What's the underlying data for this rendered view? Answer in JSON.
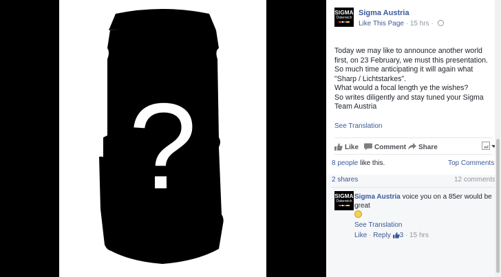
{
  "photo": {
    "symbol": "?"
  },
  "post": {
    "page_name": "Sigma Austria",
    "like_page": "Like This Page",
    "time": "· 15 hrs ·",
    "avatar_line1": "SIGMA",
    "avatar_line2": "Österreich",
    "text_lines": [
      "Today we may like to announce another world first, on 23 February, we must this presentation. So much time anticipating it will again what \"Sharp / Lichtstarkes\".",
      "What would a focal length ye the wishes?",
      "So writes diligently and stay tuned your Sigma Team Austria"
    ],
    "see_translation": "See Translation"
  },
  "actions": {
    "like": "Like",
    "comment": "Comment",
    "share": "Share"
  },
  "stats": {
    "likes_people": "8 people",
    "likes_suffix": " like this.",
    "top_comments": "Top Comments ▾",
    "shares": "2 shares",
    "comments": "12 comments"
  },
  "comment": {
    "author": "Sigma Austria",
    "text": " voice you on a 85er would be great",
    "see_translation": "See Translation",
    "like": "Like",
    "sep": " · ",
    "reply": "Reply",
    "likes_count": "3",
    "time": " · 15 hrs"
  },
  "colors": {
    "link": "#3b5998",
    "text": "#1d2129",
    "muted": "#90949c"
  }
}
